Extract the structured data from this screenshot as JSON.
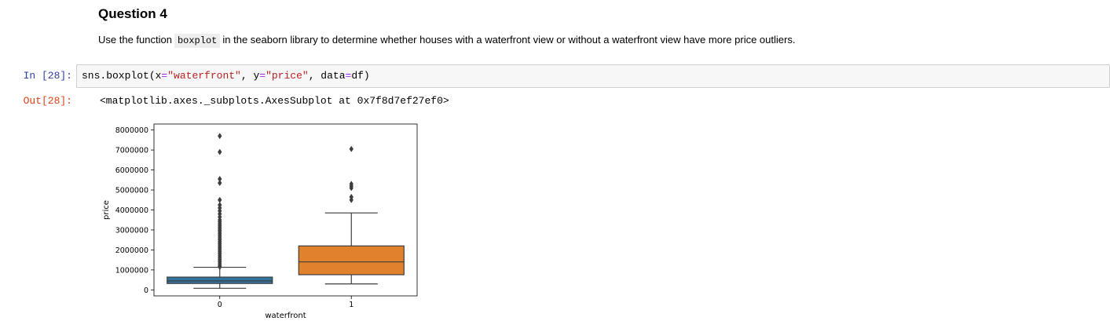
{
  "markdown": {
    "title": "Question 4",
    "text_before": "Use the function",
    "code": "boxplot",
    "text_after": "in the seaborn library to determine whether houses with a waterfront view or without a waterfront view have more price outliers."
  },
  "input_cell": {
    "prompt": "In [28]:",
    "code_parts": [
      "sns.boxplot(x",
      "=",
      "\"waterfront\"",
      ", y",
      "=",
      "\"price\"",
      ", data",
      "=",
      "df)"
    ]
  },
  "output_cell": {
    "prompt": "Out[28]:",
    "text": "<matplotlib.axes._subplots.AxesSubplot at 0x7f8d7ef27ef0>"
  },
  "chart_data": {
    "type": "box",
    "xlabel": "waterfront",
    "ylabel": "price",
    "categories": [
      "0",
      "1"
    ],
    "ylim": [
      -300000,
      8300000
    ],
    "yticks": [
      0,
      1000000,
      2000000,
      3000000,
      4000000,
      5000000,
      6000000,
      7000000,
      8000000
    ],
    "ytick_labels": [
      "0",
      "1000000",
      "2000000",
      "3000000",
      "4000000",
      "5000000",
      "6000000",
      "7000000",
      "8000000"
    ],
    "boxes": [
      {
        "category": "0",
        "color": "#3274a1",
        "whisker_low": 80000,
        "q1": 320000,
        "median": 450000,
        "q3": 640000,
        "whisker_high": 1130000,
        "outliers": [
          1150000,
          1200000,
          1300000,
          1400000,
          1500000,
          1600000,
          1700000,
          1800000,
          1900000,
          2000000,
          2100000,
          2200000,
          2300000,
          2400000,
          2500000,
          2600000,
          2700000,
          2800000,
          2900000,
          3000000,
          3100000,
          3200000,
          3300000,
          3400000,
          3500000,
          3650000,
          3800000,
          3950000,
          4100000,
          4250000,
          4500000,
          5350000,
          5550000,
          6900000,
          7700000
        ]
      },
      {
        "category": "1",
        "color": "#e1812c",
        "whisker_low": 300000,
        "q1": 760000,
        "median": 1400000,
        "q3": 2200000,
        "whisker_high": 3850000,
        "outliers": [
          4500000,
          4650000,
          5100000,
          5200000,
          5300000,
          7050000
        ]
      }
    ]
  }
}
